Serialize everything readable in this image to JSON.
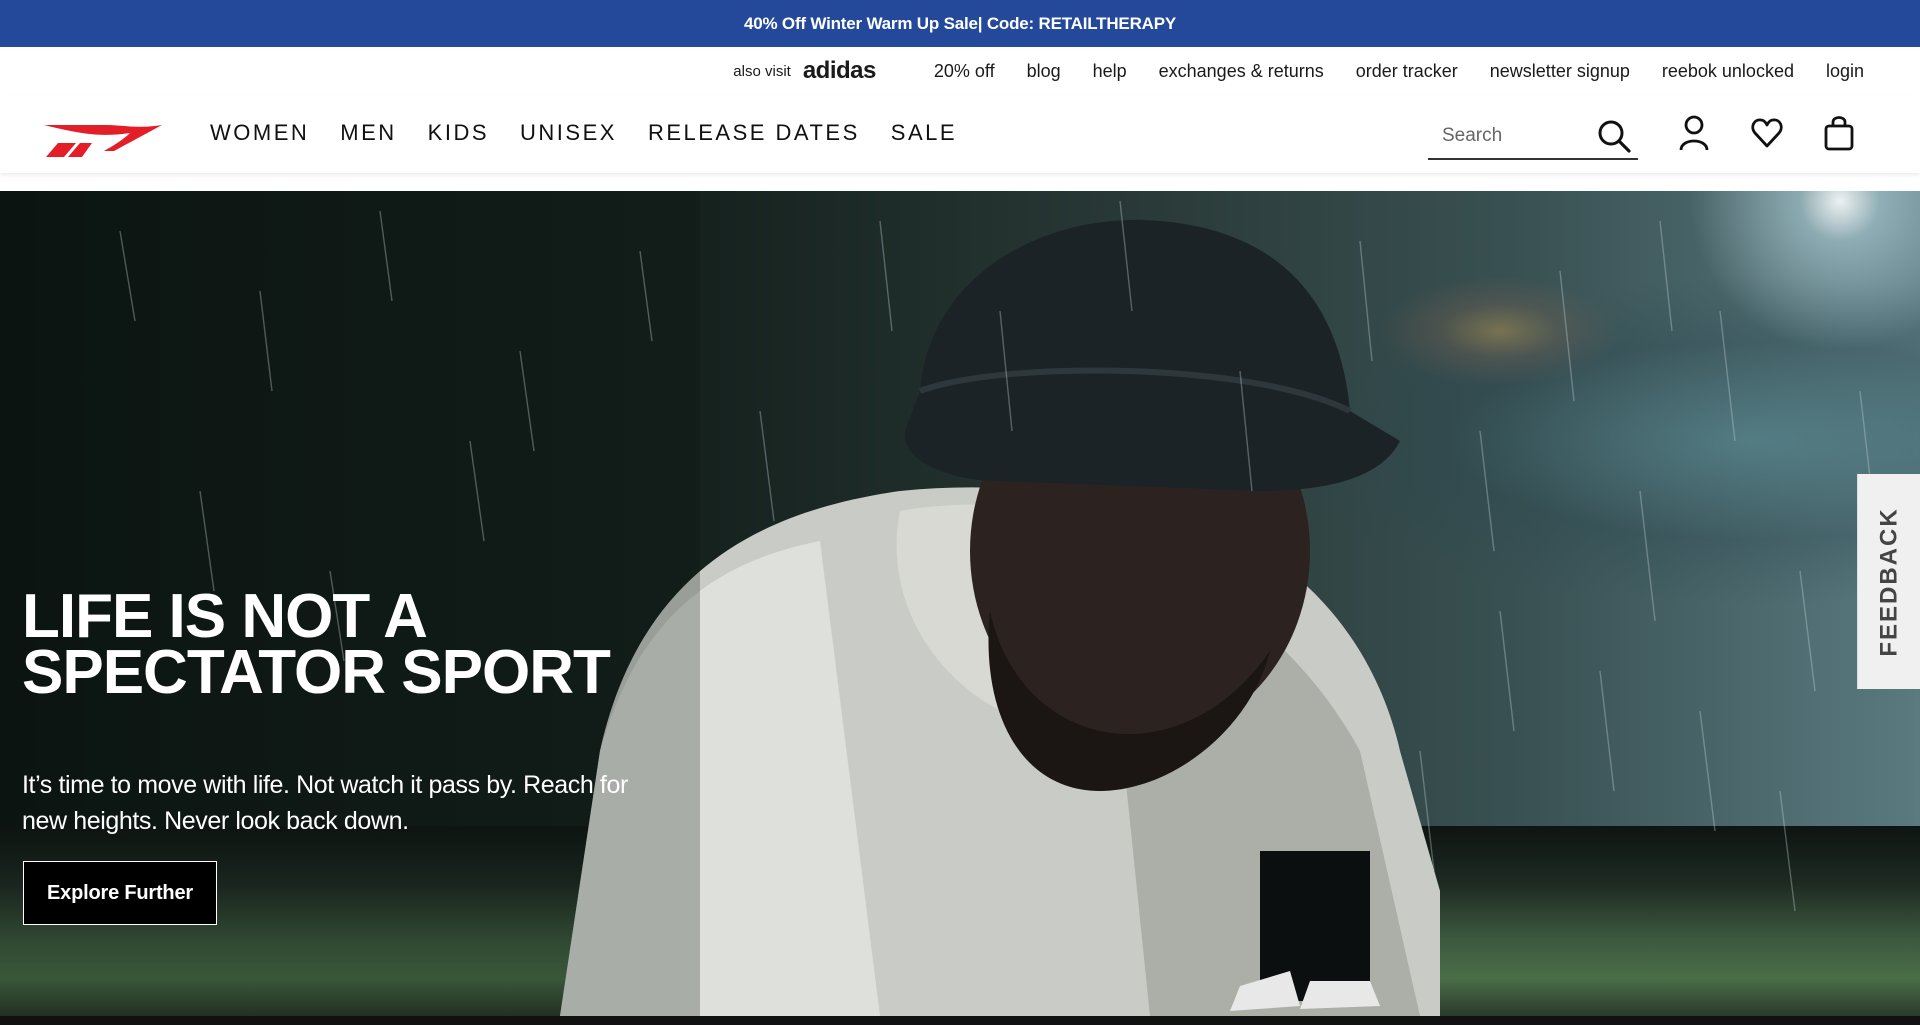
{
  "promo": {
    "text": "40% Off Winter Warm Up Sale| Code: RETAILTHERAPY"
  },
  "utility": {
    "also_visit": "also visit",
    "partner_brand": "adidas",
    "links": [
      "20% off",
      "blog",
      "help",
      "exchanges & returns",
      "order tracker",
      "newsletter signup",
      "reebok unlocked",
      "login"
    ]
  },
  "nav": {
    "items": [
      "WOMEN",
      "MEN",
      "KIDS",
      "UNISEX",
      "RELEASE DATES",
      "SALE"
    ],
    "search_placeholder": "Search",
    "icons": [
      "search-icon",
      "account-icon",
      "wishlist-heart-icon",
      "shopping-bag-icon"
    ]
  },
  "hero": {
    "title": "LIFE IS NOT A SPECTATOR SPORT",
    "body": "It’s time to move with life. Not watch it pass by. Reach for new heights. Never look back down.",
    "cta": "Explore Further"
  },
  "feedback": {
    "label": "FEEDBACK"
  },
  "colors": {
    "promo_bg": "#24489a",
    "logo_red": "#e41e26",
    "cta_bg": "#000000"
  }
}
